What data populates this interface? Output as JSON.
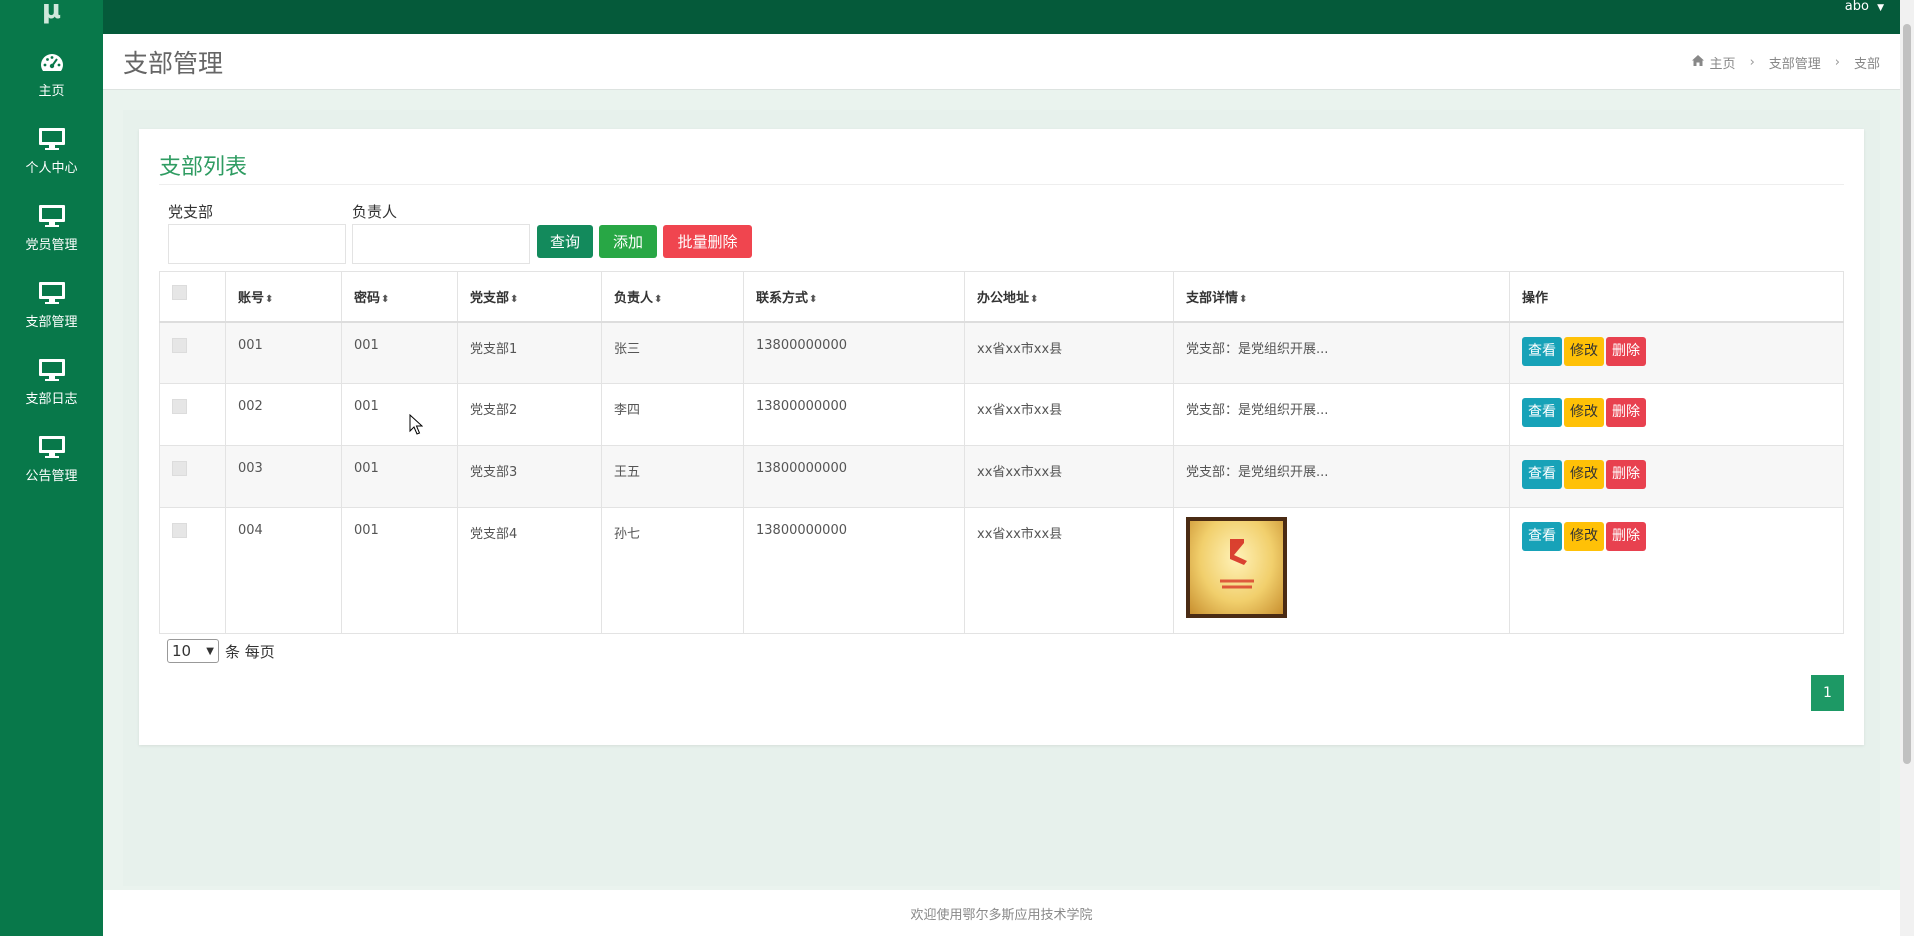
{
  "app": {
    "logo": "μ",
    "user": "abo"
  },
  "sidebar": {
    "items": [
      {
        "label": "主页",
        "icon": "dashboard-icon"
      },
      {
        "label": "个人中心",
        "icon": "monitor-icon"
      },
      {
        "label": "党员管理",
        "icon": "monitor-icon"
      },
      {
        "label": "支部管理",
        "icon": "monitor-icon"
      },
      {
        "label": "支部日志",
        "icon": "monitor-icon"
      },
      {
        "label": "公告管理",
        "icon": "monitor-icon"
      }
    ]
  },
  "header": {
    "title": "支部管理",
    "breadcrumb": [
      "主页",
      "支部管理",
      "支部"
    ]
  },
  "card": {
    "title": "支部列表"
  },
  "filters": {
    "branch_label": "党支部",
    "branch_value": "",
    "leader_label": "负责人",
    "leader_value": ""
  },
  "buttons": {
    "search": "查询",
    "add": "添加",
    "batch_delete": "批量删除"
  },
  "table": {
    "columns": [
      "账号",
      "密码",
      "党支部",
      "负责人",
      "联系方式",
      "办公地址",
      "支部详情",
      "操作"
    ],
    "rows": [
      {
        "account": "001",
        "password": "001",
        "branch": "党支部1",
        "leader": "张三",
        "phone": "13800000000",
        "address": "xx省xx市xx县",
        "detail": "党支部：是党组织开展..."
      },
      {
        "account": "002",
        "password": "001",
        "branch": "党支部2",
        "leader": "李四",
        "phone": "13800000000",
        "address": "xx省xx市xx县",
        "detail": "党支部：是党组织开展..."
      },
      {
        "account": "003",
        "password": "001",
        "branch": "党支部3",
        "leader": "王五",
        "phone": "13800000000",
        "address": "xx省xx市xx县",
        "detail": "党支部：是党组织开展..."
      },
      {
        "account": "004",
        "password": "001",
        "branch": "党支部4",
        "leader": "孙七",
        "phone": "13800000000",
        "address": "xx省xx市xx县",
        "detail": ""
      }
    ],
    "actions": {
      "view": "查看",
      "edit": "修改",
      "delete": "删除"
    }
  },
  "pager": {
    "page_size": "10",
    "suffix": "条 每页",
    "current_page": "1"
  },
  "footer": {
    "text": "欢迎使用鄂尔多斯应用技术学院"
  },
  "colors": {
    "sidebar": "#08784a",
    "topbar": "#055a3a",
    "accent": "#2f9c62",
    "view": "#17a2b8",
    "edit": "#ffc107",
    "delete": "#e8414f"
  }
}
